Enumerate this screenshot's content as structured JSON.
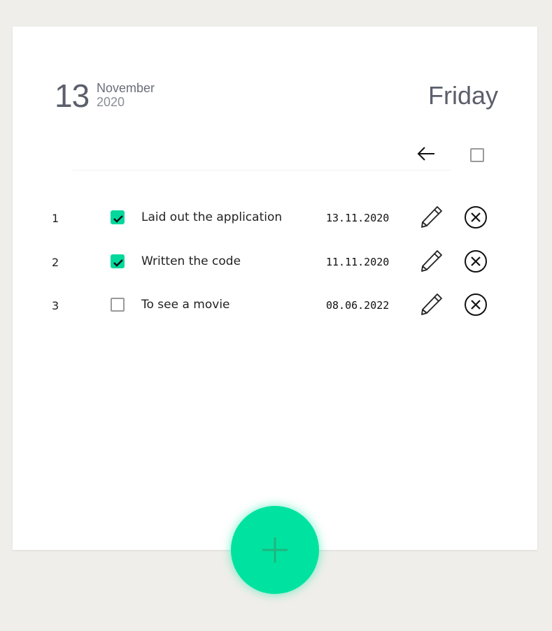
{
  "header": {
    "day": "13",
    "month": "November",
    "year": "2020",
    "weekday": "Friday"
  },
  "tasks": [
    {
      "num": "1",
      "text": "Laid out the application",
      "date": "13.11.2020",
      "done": true
    },
    {
      "num": "2",
      "text": "Written the code",
      "date": "11.11.2020",
      "done": true
    },
    {
      "num": "3",
      "text": "To see a movie",
      "date": "08.06.2022",
      "done": false
    }
  ],
  "colors": {
    "accent": "#00e3a0",
    "background": "#efeeea"
  }
}
